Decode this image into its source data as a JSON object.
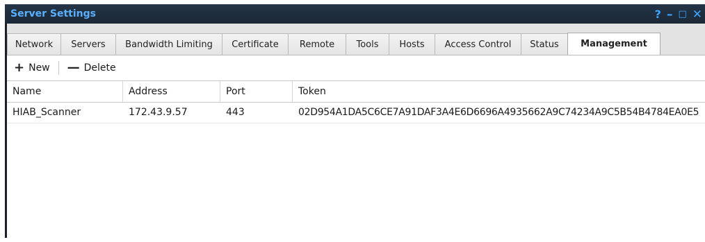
{
  "window": {
    "title": "Server Settings",
    "controls": {
      "help": "?",
      "minimize": "–",
      "maximize": "□",
      "close": "✕"
    }
  },
  "tabs": [
    {
      "label": "Network"
    },
    {
      "label": "Servers"
    },
    {
      "label": "Bandwidth Limiting"
    },
    {
      "label": "Certificate"
    },
    {
      "label": "Remote"
    },
    {
      "label": "Tools"
    },
    {
      "label": "Hosts"
    },
    {
      "label": "Access Control"
    },
    {
      "label": "Status"
    },
    {
      "label": "Management",
      "active": true
    }
  ],
  "toolbar": {
    "new_icon": "+",
    "new_label": "New",
    "delete_icon": "—",
    "delete_label": "Delete"
  },
  "table": {
    "columns": [
      "Name",
      "Address",
      "Port",
      "Token"
    ],
    "rows": [
      {
        "name": "HIAB_Scanner",
        "address": "172.43.9.57",
        "port": "443",
        "token": "02D954A1DA5C6CE7A91DAF3A4E6D6696A4935662A9C74234A9C5B54B4784EA0E5"
      }
    ]
  },
  "colors": {
    "title_bar": "#1b2837",
    "title_text": "#5ab0ff",
    "window_controls": "#3da4ff",
    "tab_bar": "#e3e3e3"
  }
}
